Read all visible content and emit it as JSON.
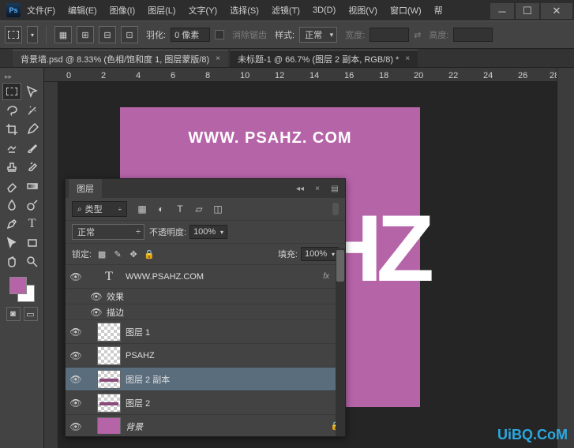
{
  "app": {
    "logo": "Ps"
  },
  "menu": [
    "文件(F)",
    "编辑(E)",
    "图像(I)",
    "图层(L)",
    "文字(Y)",
    "选择(S)",
    "滤镜(T)",
    "3D(D)",
    "视图(V)",
    "窗口(W)",
    "帮"
  ],
  "optbar": {
    "feather_label": "羽化:",
    "feather_value": "0 像素",
    "antialias": "消除锯齿",
    "style_label": "样式:",
    "style_value": "正常",
    "width_label": "宽度:",
    "height_label": "高度:"
  },
  "tabs": [
    {
      "label": "背景墙.psd @ 8.33% (色相/饱和度 1, 图层蒙版/8)",
      "close": "×"
    },
    {
      "label": "未标题-1 @ 66.7% (图层 2 副本, RGB/8) *",
      "close": "×"
    }
  ],
  "ruler": {
    "marks": [
      "0",
      "2",
      "4",
      "6",
      "8",
      "10",
      "12",
      "14",
      "16",
      "18",
      "20",
      "22",
      "24",
      "26",
      "28"
    ]
  },
  "artwork": {
    "url": "WWW. PSAHZ. COM",
    "big": "HZ"
  },
  "layers_panel": {
    "title": "图层",
    "search_label": "类型",
    "blend": "正常",
    "opacity_label": "不透明度:",
    "opacity_value": "100%",
    "lock_label": "锁定:",
    "fill_label": "填充:",
    "fill_value": "100%",
    "items": [
      {
        "name": "WWW.PSAHZ.COM",
        "type": "text",
        "fx": "fx"
      },
      {
        "name": "效果",
        "type": "sub"
      },
      {
        "name": "描边",
        "type": "sub"
      },
      {
        "name": "图层 1",
        "type": "raster"
      },
      {
        "name": "PSAHZ",
        "type": "raster"
      },
      {
        "name": "图层 2 副本",
        "type": "raster",
        "selected": true
      },
      {
        "name": "图层 2",
        "type": "raster"
      },
      {
        "name": "背景",
        "type": "bg",
        "locked": true
      }
    ]
  },
  "watermark": "UiBQ.CoM",
  "colors": {
    "canvas": "#b664a8"
  }
}
